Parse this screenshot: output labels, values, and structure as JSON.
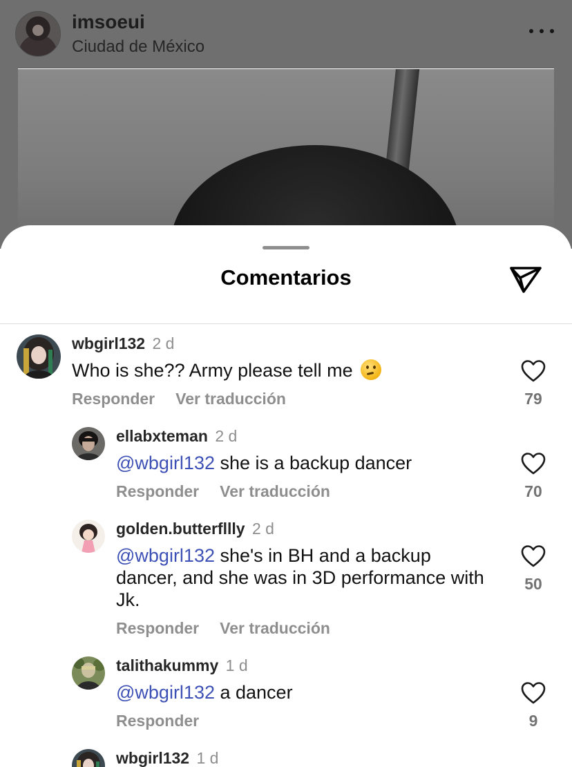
{
  "post": {
    "username": "imsoeui",
    "location": "Ciudad de México"
  },
  "sheet": {
    "title": "Comentarios"
  },
  "labels": {
    "reply": "Responder",
    "translate": "Ver traducción"
  },
  "comments": [
    {
      "username": "wbgirl132",
      "time": "2 d",
      "mention": "",
      "text": "Who is she?? Army please tell me",
      "emoji": "thinking-face",
      "likes": "79",
      "has_translate": true
    },
    {
      "username": "ellabxteman",
      "time": "2 d",
      "mention": "@wbgirl132",
      "text": " she is a backup dancer",
      "likes": "70",
      "has_translate": true
    },
    {
      "username": "golden.butterfllly",
      "time": "2 d",
      "mention": "@wbgirl132",
      "text": " she's in BH and a backup dancer, and she was in 3D performance with Jk.",
      "likes": "50",
      "has_translate": true
    },
    {
      "username": "talithakummy",
      "time": "1 d",
      "mention": "@wbgirl132",
      "text": " a dancer",
      "likes": "9",
      "has_translate": false
    },
    {
      "username": "wbgirl132",
      "time": "1 d"
    }
  ],
  "icons": {
    "more": "more-horizontal-icon",
    "share": "paper-plane-icon",
    "like": "heart-outline-icon"
  }
}
